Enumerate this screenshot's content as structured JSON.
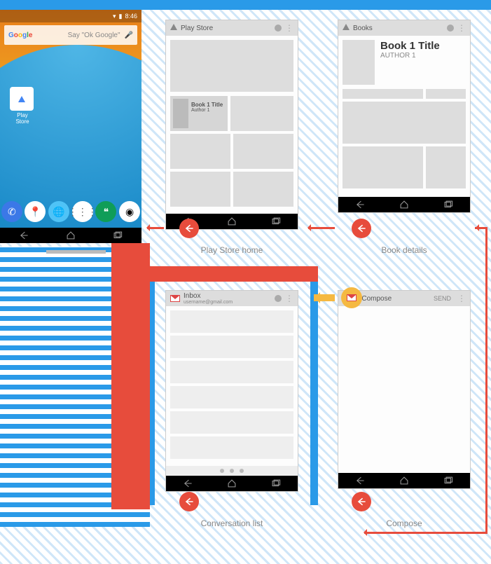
{
  "phone": {
    "status_time": "8:46",
    "search_logo": "Google",
    "search_hint": "Say \"Ok Google\"",
    "app_icon_label": "Play Store"
  },
  "mocks": {
    "play_store": {
      "header": "Play Store",
      "caption": "Play Store home",
      "book_card_title": "Book 1 Title",
      "book_card_author": "Author 1"
    },
    "books": {
      "header": "Books",
      "caption": "Book details",
      "title": "Book 1 Title",
      "author": "AUTHOR 1"
    },
    "inbox": {
      "header": "Inbox",
      "header_sub": "username@gmail.com",
      "caption": "Conversation list"
    },
    "compose": {
      "header": "Compose",
      "send": "SEND",
      "caption": "Compose"
    }
  }
}
